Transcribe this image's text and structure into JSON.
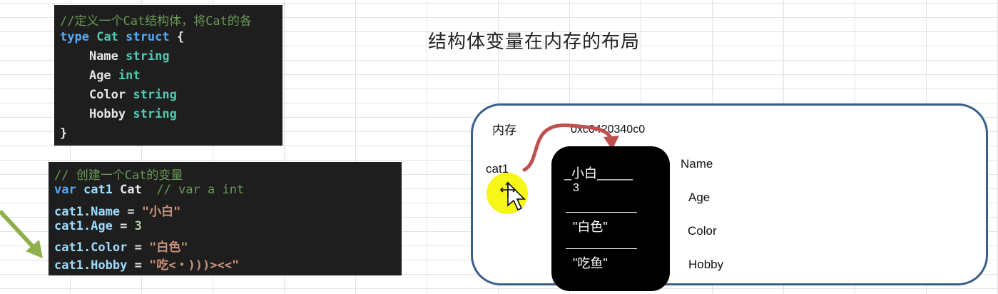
{
  "code_struct": {
    "comment": "//定义一个Cat结构体，将Cat的各",
    "kw_type": "type",
    "type_name": "Cat",
    "kw_struct": "struct",
    "open_brace": "{",
    "fields": [
      {
        "name": "Name",
        "type": "string"
      },
      {
        "name": "Age",
        "type": "int"
      },
      {
        "name": "Color",
        "type": "string"
      },
      {
        "name": "Hobby",
        "type": "string"
      }
    ],
    "close_brace": "}"
  },
  "code_var": {
    "comment": "// 创建一个Cat的变量",
    "kw_var": "var",
    "var_name": "cat1",
    "var_type": "Cat",
    "inline_comment": "// var a int",
    "assignments": [
      {
        "lhs": "cat1.Name",
        "op": " = ",
        "rhs": "\"小白\""
      },
      {
        "lhs": "cat1.Age",
        "op": " = ",
        "rhs": "3"
      },
      {
        "lhs": "cat1.Color",
        "op": " = ",
        "rhs": "\"白色\""
      },
      {
        "lhs": "cat1.Hobby",
        "op": " = ",
        "rhs": "\"吃<・)))><<\""
      }
    ]
  },
  "diagram": {
    "title": "结构体变量在内存的布局",
    "memory_label": "内存",
    "address": "0xc0420340c0",
    "variable": "cat1",
    "cell_values": [
      "_小白_____",
      "3",
      "\"白色\"",
      "\"吃鱼\""
    ],
    "field_labels": [
      "Name",
      "Age",
      "Color",
      "Hobby"
    ]
  },
  "colors": {
    "code_bg": "#1e1e1e",
    "arrow": "#c0504d",
    "highlight": "#f5f500",
    "pointer_arrow": "#8db04a",
    "box_border": "#3a5f8a"
  }
}
